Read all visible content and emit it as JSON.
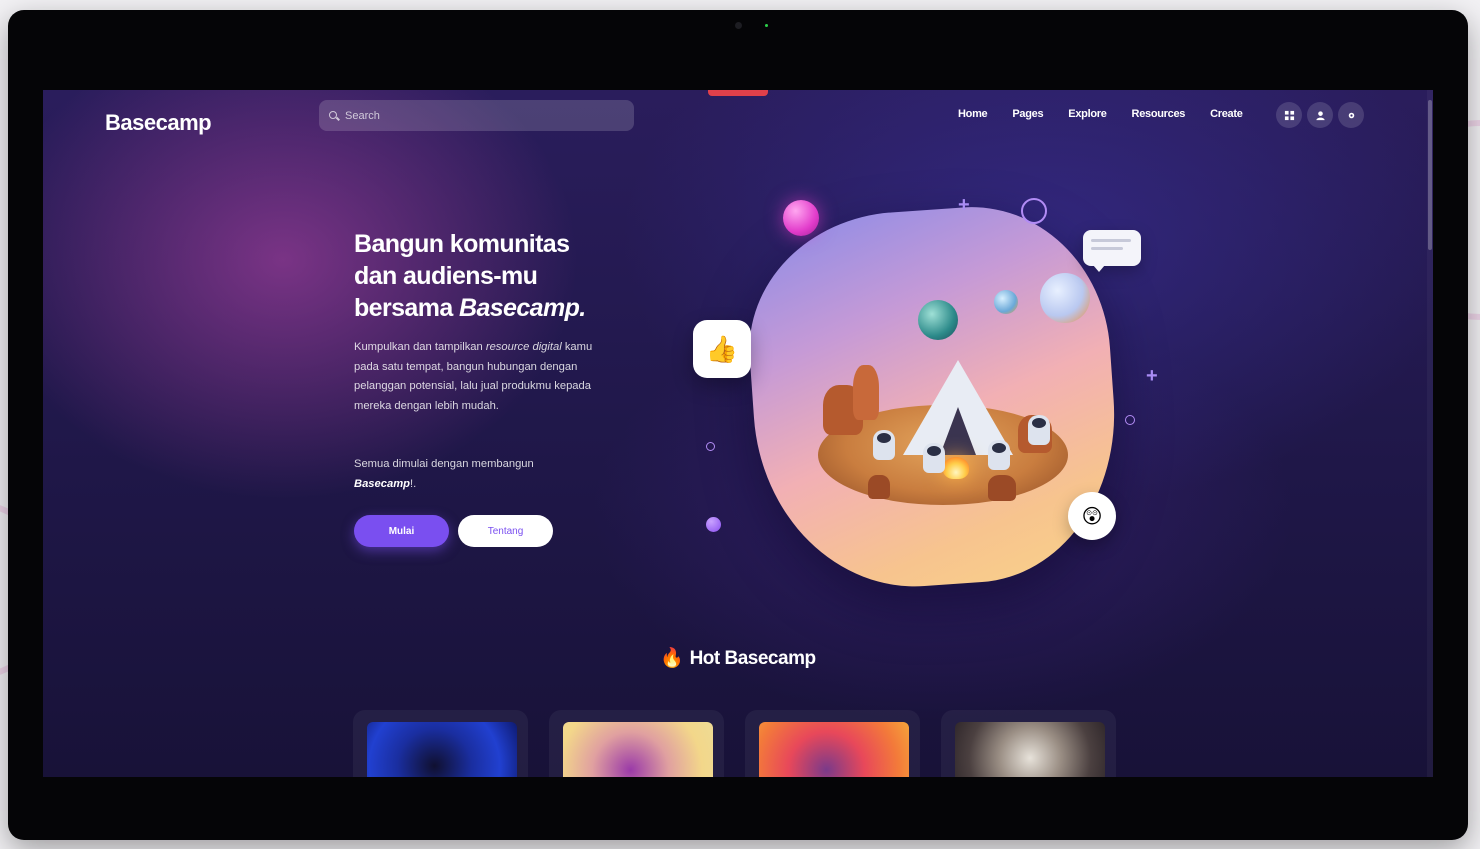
{
  "site": {
    "logo": "Basecamp"
  },
  "search": {
    "placeholder": "Search"
  },
  "nav": {
    "items": [
      "Home",
      "Pages",
      "Explore",
      "Resources",
      "Create"
    ]
  },
  "header_icons": [
    "grid-icon",
    "user-icon",
    "settings-icon"
  ],
  "hero": {
    "title_line1": "Bangun komunitas",
    "title_line2": "dan audiens-mu",
    "title_line3_prefix": "bersama ",
    "title_brand": "Basecamp.",
    "desc_part1": "Kumpulkan dan tampilkan ",
    "desc_em1": "resource digital",
    "desc_part2": " kamu pada satu tempat, bangun hubungan dengan pelanggan potensial, lalu jual produkmu kepada mereka dengan lebih mudah.",
    "desc2_part1": "Semua dimulai dengan membangun ",
    "desc2_brand": "Basecamp",
    "desc2_end": "!.",
    "primary_button": "Mulai",
    "secondary_button": "Tentang"
  },
  "hot_section": {
    "title": "Hot Basecamp",
    "icon": "flame-icon",
    "cards": [
      {
        "thumb_colors": [
          "#1a2ea0",
          "#101030"
        ]
      },
      {
        "thumb_colors": [
          "#f3d78a",
          "#9a3aa8"
        ]
      },
      {
        "thumb_colors": [
          "#f37a3a",
          "#e8485a"
        ]
      },
      {
        "thumb_colors": [
          "#9b8f85",
          "#e7e2da"
        ]
      }
    ]
  },
  "colors": {
    "accent": "#7a4ff0",
    "background": "#1f1748",
    "pink_glow": "#e23ccb"
  }
}
